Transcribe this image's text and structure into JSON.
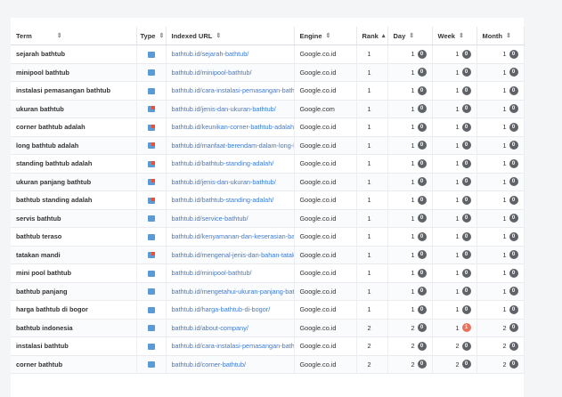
{
  "columns": {
    "term": "Term",
    "type": "Type",
    "url": "Indexed URL",
    "engine": "Engine",
    "rank": "Rank",
    "day": "Day",
    "week": "Week",
    "month": "Month"
  },
  "rows": [
    {
      "term": "sejarah bathtub",
      "type_icon": "page-icon",
      "url": "bathtub.id/sejarah-bathtub/",
      "engine": "Google.co.id",
      "rank": "1",
      "day": "1",
      "day_change": "0",
      "week": "1",
      "week_change": "0",
      "month": "1",
      "month_change": "0"
    },
    {
      "term": "minipool bathtub",
      "type_icon": "page-icon",
      "url": "bathtub.id/minipool-bathtub/",
      "engine": "Google.co.id",
      "rank": "1",
      "day": "1",
      "day_change": "0",
      "week": "1",
      "week_change": "0",
      "month": "1",
      "month_change": "0"
    },
    {
      "term": "instalasi pemasangan bathtub",
      "type_icon": "page-icon",
      "url": "bathtub.id/cara-instalasi-pemasangan-bathtub",
      "engine": "Google.co.id",
      "rank": "1",
      "day": "1",
      "day_change": "0",
      "week": "1",
      "week_change": "0",
      "month": "1",
      "month_change": "0"
    },
    {
      "term": "ukuran bathtub",
      "type_icon": "image-icon",
      "url": "bathtub.id/jenis-dan-ukuran-bathtub/",
      "engine": "Google.com",
      "rank": "1",
      "day": "1",
      "day_change": "0",
      "week": "1",
      "week_change": "0",
      "month": "1",
      "month_change": "0"
    },
    {
      "term": "corner bathtub adalah",
      "type_icon": "image-icon",
      "url": "bathtub.id/keunikan-corner-bathtub-adalah/",
      "engine": "Google.co.id",
      "rank": "1",
      "day": "1",
      "day_change": "0",
      "week": "1",
      "week_change": "0",
      "month": "1",
      "month_change": "0"
    },
    {
      "term": "long bathtub adalah",
      "type_icon": "image-icon",
      "url": "bathtub.id/manfaat-berendam-dalam-long-bathtub",
      "engine": "Google.co.id",
      "rank": "1",
      "day": "1",
      "day_change": "0",
      "week": "1",
      "week_change": "0",
      "month": "1",
      "month_change": "0"
    },
    {
      "term": "standing bathtub adalah",
      "type_icon": "image-icon",
      "url": "bathtub.id/bathtub-standing-adalah/",
      "engine": "Google.co.id",
      "rank": "1",
      "day": "1",
      "day_change": "0",
      "week": "1",
      "week_change": "0",
      "month": "1",
      "month_change": "0"
    },
    {
      "term": "ukuran panjang bathtub",
      "type_icon": "image-icon",
      "url": "bathtub.id/jenis-dan-ukuran-bathtub/",
      "engine": "Google.co.id",
      "rank": "1",
      "day": "1",
      "day_change": "0",
      "week": "1",
      "week_change": "0",
      "month": "1",
      "month_change": "0"
    },
    {
      "term": "bathtub standing adalah",
      "type_icon": "image-icon",
      "url": "bathtub.id/bathtub-standing-adalah/",
      "engine": "Google.co.id",
      "rank": "1",
      "day": "1",
      "day_change": "0",
      "week": "1",
      "week_change": "0",
      "month": "1",
      "month_change": "0"
    },
    {
      "term": "servis bathtub",
      "type_icon": "page-icon",
      "url": "bathtub.id/service-bathtub/",
      "engine": "Google.co.id",
      "rank": "1",
      "day": "1",
      "day_change": "0",
      "week": "1",
      "week_change": "0",
      "month": "1",
      "month_change": "0"
    },
    {
      "term": "bathtub teraso",
      "type_icon": "page-icon",
      "url": "bathtub.id/kenyamanan-dan-keserasian-bathtub",
      "engine": "Google.co.id",
      "rank": "1",
      "day": "1",
      "day_change": "0",
      "week": "1",
      "week_change": "0",
      "month": "1",
      "month_change": "0"
    },
    {
      "term": "tatakan mandi",
      "type_icon": "image-icon",
      "url": "bathtub.id/mengenal-jenis-dan-bahan-tatakan",
      "engine": "Google.co.id",
      "rank": "1",
      "day": "1",
      "day_change": "0",
      "week": "1",
      "week_change": "0",
      "month": "1",
      "month_change": "0"
    },
    {
      "term": "mini pool bathtub",
      "type_icon": "page-icon",
      "url": "bathtub.id/minipool-bathtub/",
      "engine": "Google.co.id",
      "rank": "1",
      "day": "1",
      "day_change": "0",
      "week": "1",
      "week_change": "0",
      "month": "1",
      "month_change": "0"
    },
    {
      "term": "bathtub panjang",
      "type_icon": "page-icon",
      "url": "bathtub.id/mengetahui-ukuran-panjang-bathtub",
      "engine": "Google.co.id",
      "rank": "1",
      "day": "1",
      "day_change": "0",
      "week": "1",
      "week_change": "0",
      "month": "1",
      "month_change": "0"
    },
    {
      "term": "harga bathtub di bogor",
      "type_icon": "page-icon",
      "url": "bathtub.id/harga-bathtub-di-bogor/",
      "engine": "Google.co.id",
      "rank": "1",
      "day": "1",
      "day_change": "0",
      "week": "1",
      "week_change": "0",
      "month": "1",
      "month_change": "0"
    },
    {
      "term": "bathtub indonesia",
      "type_icon": "page-icon",
      "url": "bathtub.id/about-company/",
      "engine": "Google.co.id",
      "rank": "2",
      "day": "2",
      "day_change": "0",
      "week": "1",
      "week_change": "1",
      "month": "2",
      "month_change": "0"
    },
    {
      "term": "instalasi bathtub",
      "type_icon": "page-icon",
      "url": "bathtub.id/cara-instalasi-pemasangan-bathtub",
      "engine": "Google.co.id",
      "rank": "2",
      "day": "2",
      "day_change": "0",
      "week": "2",
      "week_change": "0",
      "month": "2",
      "month_change": "0"
    },
    {
      "term": "corner bathtub",
      "type_icon": "page-icon",
      "url": "bathtub.id/corner-bathtub/",
      "engine": "Google.co.id",
      "rank": "2",
      "day": "2",
      "day_change": "0",
      "week": "2",
      "week_change": "0",
      "month": "2",
      "month_change": "0"
    }
  ],
  "colors": {
    "link": "#3a7bd5",
    "badge_neutral": "#5f6368",
    "badge_negative": "#e8735a"
  }
}
